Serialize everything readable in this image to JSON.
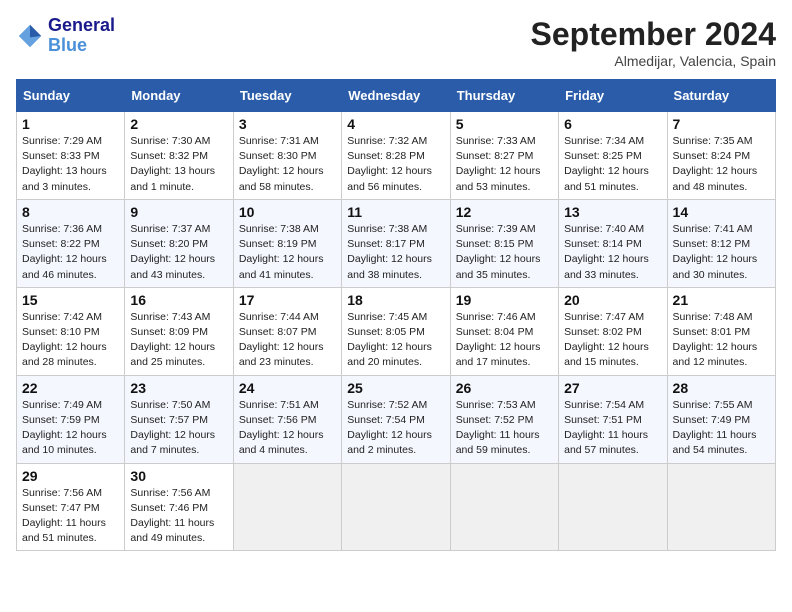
{
  "header": {
    "logo_line1": "General",
    "logo_line2": "Blue",
    "month": "September 2024",
    "location": "Almedijar, Valencia, Spain"
  },
  "columns": [
    "Sunday",
    "Monday",
    "Tuesday",
    "Wednesday",
    "Thursday",
    "Friday",
    "Saturday"
  ],
  "weeks": [
    [
      {
        "day": "1",
        "sunrise": "Sunrise: 7:29 AM",
        "sunset": "Sunset: 8:33 PM",
        "daylight": "Daylight: 13 hours and 3 minutes."
      },
      {
        "day": "2",
        "sunrise": "Sunrise: 7:30 AM",
        "sunset": "Sunset: 8:32 PM",
        "daylight": "Daylight: 13 hours and 1 minute."
      },
      {
        "day": "3",
        "sunrise": "Sunrise: 7:31 AM",
        "sunset": "Sunset: 8:30 PM",
        "daylight": "Daylight: 12 hours and 58 minutes."
      },
      {
        "day": "4",
        "sunrise": "Sunrise: 7:32 AM",
        "sunset": "Sunset: 8:28 PM",
        "daylight": "Daylight: 12 hours and 56 minutes."
      },
      {
        "day": "5",
        "sunrise": "Sunrise: 7:33 AM",
        "sunset": "Sunset: 8:27 PM",
        "daylight": "Daylight: 12 hours and 53 minutes."
      },
      {
        "day": "6",
        "sunrise": "Sunrise: 7:34 AM",
        "sunset": "Sunset: 8:25 PM",
        "daylight": "Daylight: 12 hours and 51 minutes."
      },
      {
        "day": "7",
        "sunrise": "Sunrise: 7:35 AM",
        "sunset": "Sunset: 8:24 PM",
        "daylight": "Daylight: 12 hours and 48 minutes."
      }
    ],
    [
      {
        "day": "8",
        "sunrise": "Sunrise: 7:36 AM",
        "sunset": "Sunset: 8:22 PM",
        "daylight": "Daylight: 12 hours and 46 minutes."
      },
      {
        "day": "9",
        "sunrise": "Sunrise: 7:37 AM",
        "sunset": "Sunset: 8:20 PM",
        "daylight": "Daylight: 12 hours and 43 minutes."
      },
      {
        "day": "10",
        "sunrise": "Sunrise: 7:38 AM",
        "sunset": "Sunset: 8:19 PM",
        "daylight": "Daylight: 12 hours and 41 minutes."
      },
      {
        "day": "11",
        "sunrise": "Sunrise: 7:38 AM",
        "sunset": "Sunset: 8:17 PM",
        "daylight": "Daylight: 12 hours and 38 minutes."
      },
      {
        "day": "12",
        "sunrise": "Sunrise: 7:39 AM",
        "sunset": "Sunset: 8:15 PM",
        "daylight": "Daylight: 12 hours and 35 minutes."
      },
      {
        "day": "13",
        "sunrise": "Sunrise: 7:40 AM",
        "sunset": "Sunset: 8:14 PM",
        "daylight": "Daylight: 12 hours and 33 minutes."
      },
      {
        "day": "14",
        "sunrise": "Sunrise: 7:41 AM",
        "sunset": "Sunset: 8:12 PM",
        "daylight": "Daylight: 12 hours and 30 minutes."
      }
    ],
    [
      {
        "day": "15",
        "sunrise": "Sunrise: 7:42 AM",
        "sunset": "Sunset: 8:10 PM",
        "daylight": "Daylight: 12 hours and 28 minutes."
      },
      {
        "day": "16",
        "sunrise": "Sunrise: 7:43 AM",
        "sunset": "Sunset: 8:09 PM",
        "daylight": "Daylight: 12 hours and 25 minutes."
      },
      {
        "day": "17",
        "sunrise": "Sunrise: 7:44 AM",
        "sunset": "Sunset: 8:07 PM",
        "daylight": "Daylight: 12 hours and 23 minutes."
      },
      {
        "day": "18",
        "sunrise": "Sunrise: 7:45 AM",
        "sunset": "Sunset: 8:05 PM",
        "daylight": "Daylight: 12 hours and 20 minutes."
      },
      {
        "day": "19",
        "sunrise": "Sunrise: 7:46 AM",
        "sunset": "Sunset: 8:04 PM",
        "daylight": "Daylight: 12 hours and 17 minutes."
      },
      {
        "day": "20",
        "sunrise": "Sunrise: 7:47 AM",
        "sunset": "Sunset: 8:02 PM",
        "daylight": "Daylight: 12 hours and 15 minutes."
      },
      {
        "day": "21",
        "sunrise": "Sunrise: 7:48 AM",
        "sunset": "Sunset: 8:01 PM",
        "daylight": "Daylight: 12 hours and 12 minutes."
      }
    ],
    [
      {
        "day": "22",
        "sunrise": "Sunrise: 7:49 AM",
        "sunset": "Sunset: 7:59 PM",
        "daylight": "Daylight: 12 hours and 10 minutes."
      },
      {
        "day": "23",
        "sunrise": "Sunrise: 7:50 AM",
        "sunset": "Sunset: 7:57 PM",
        "daylight": "Daylight: 12 hours and 7 minutes."
      },
      {
        "day": "24",
        "sunrise": "Sunrise: 7:51 AM",
        "sunset": "Sunset: 7:56 PM",
        "daylight": "Daylight: 12 hours and 4 minutes."
      },
      {
        "day": "25",
        "sunrise": "Sunrise: 7:52 AM",
        "sunset": "Sunset: 7:54 PM",
        "daylight": "Daylight: 12 hours and 2 minutes."
      },
      {
        "day": "26",
        "sunrise": "Sunrise: 7:53 AM",
        "sunset": "Sunset: 7:52 PM",
        "daylight": "Daylight: 11 hours and 59 minutes."
      },
      {
        "day": "27",
        "sunrise": "Sunrise: 7:54 AM",
        "sunset": "Sunset: 7:51 PM",
        "daylight": "Daylight: 11 hours and 57 minutes."
      },
      {
        "day": "28",
        "sunrise": "Sunrise: 7:55 AM",
        "sunset": "Sunset: 7:49 PM",
        "daylight": "Daylight: 11 hours and 54 minutes."
      }
    ],
    [
      {
        "day": "29",
        "sunrise": "Sunrise: 7:56 AM",
        "sunset": "Sunset: 7:47 PM",
        "daylight": "Daylight: 11 hours and 51 minutes."
      },
      {
        "day": "30",
        "sunrise": "Sunrise: 7:56 AM",
        "sunset": "Sunset: 7:46 PM",
        "daylight": "Daylight: 11 hours and 49 minutes."
      },
      null,
      null,
      null,
      null,
      null
    ]
  ]
}
